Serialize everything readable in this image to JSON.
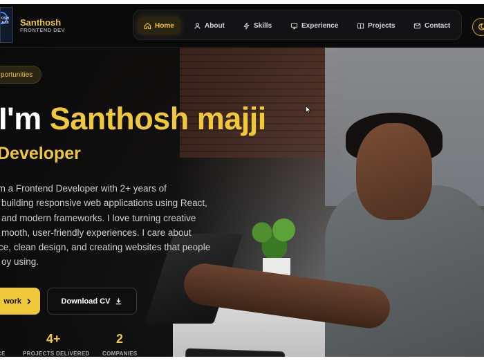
{
  "brand": {
    "name": "Santhosh",
    "subtitle": "FRONTEND DEV",
    "logo_text": "OSH\nAJJI"
  },
  "nav": {
    "items": [
      {
        "label": "Home",
        "icon": "home-icon",
        "active": true
      },
      {
        "label": "About",
        "icon": "user-icon"
      },
      {
        "label": "Skills",
        "icon": "bolt-icon"
      },
      {
        "label": "Experience",
        "icon": "monitor-icon"
      },
      {
        "label": "Projects",
        "icon": "book-icon"
      },
      {
        "label": "Contact",
        "icon": "mail-icon"
      }
    ]
  },
  "hero": {
    "badge": "portunities",
    "greeting_prefix": "I'm ",
    "name": "Santhosh majji",
    "role": "Developer",
    "description_lines": [
      "'m a Frontend Developer with 2+ years of",
      "building responsive web applications using React,",
      "and modern frameworks. I love turning creative",
      "mooth, user-friendly experiences. I care about",
      "ce, clean design, and creating websites that people",
      "oy using."
    ],
    "primary_button": "work",
    "secondary_button": "Download CV"
  },
  "stats": [
    {
      "value": "",
      "label": "CE"
    },
    {
      "value": "4+",
      "label": "PROJECTS DELIVERED"
    },
    {
      "value": "2",
      "label": "COMPANIES"
    }
  ],
  "colors": {
    "accent": "#f0c93a",
    "background": "#0b0b0c"
  }
}
